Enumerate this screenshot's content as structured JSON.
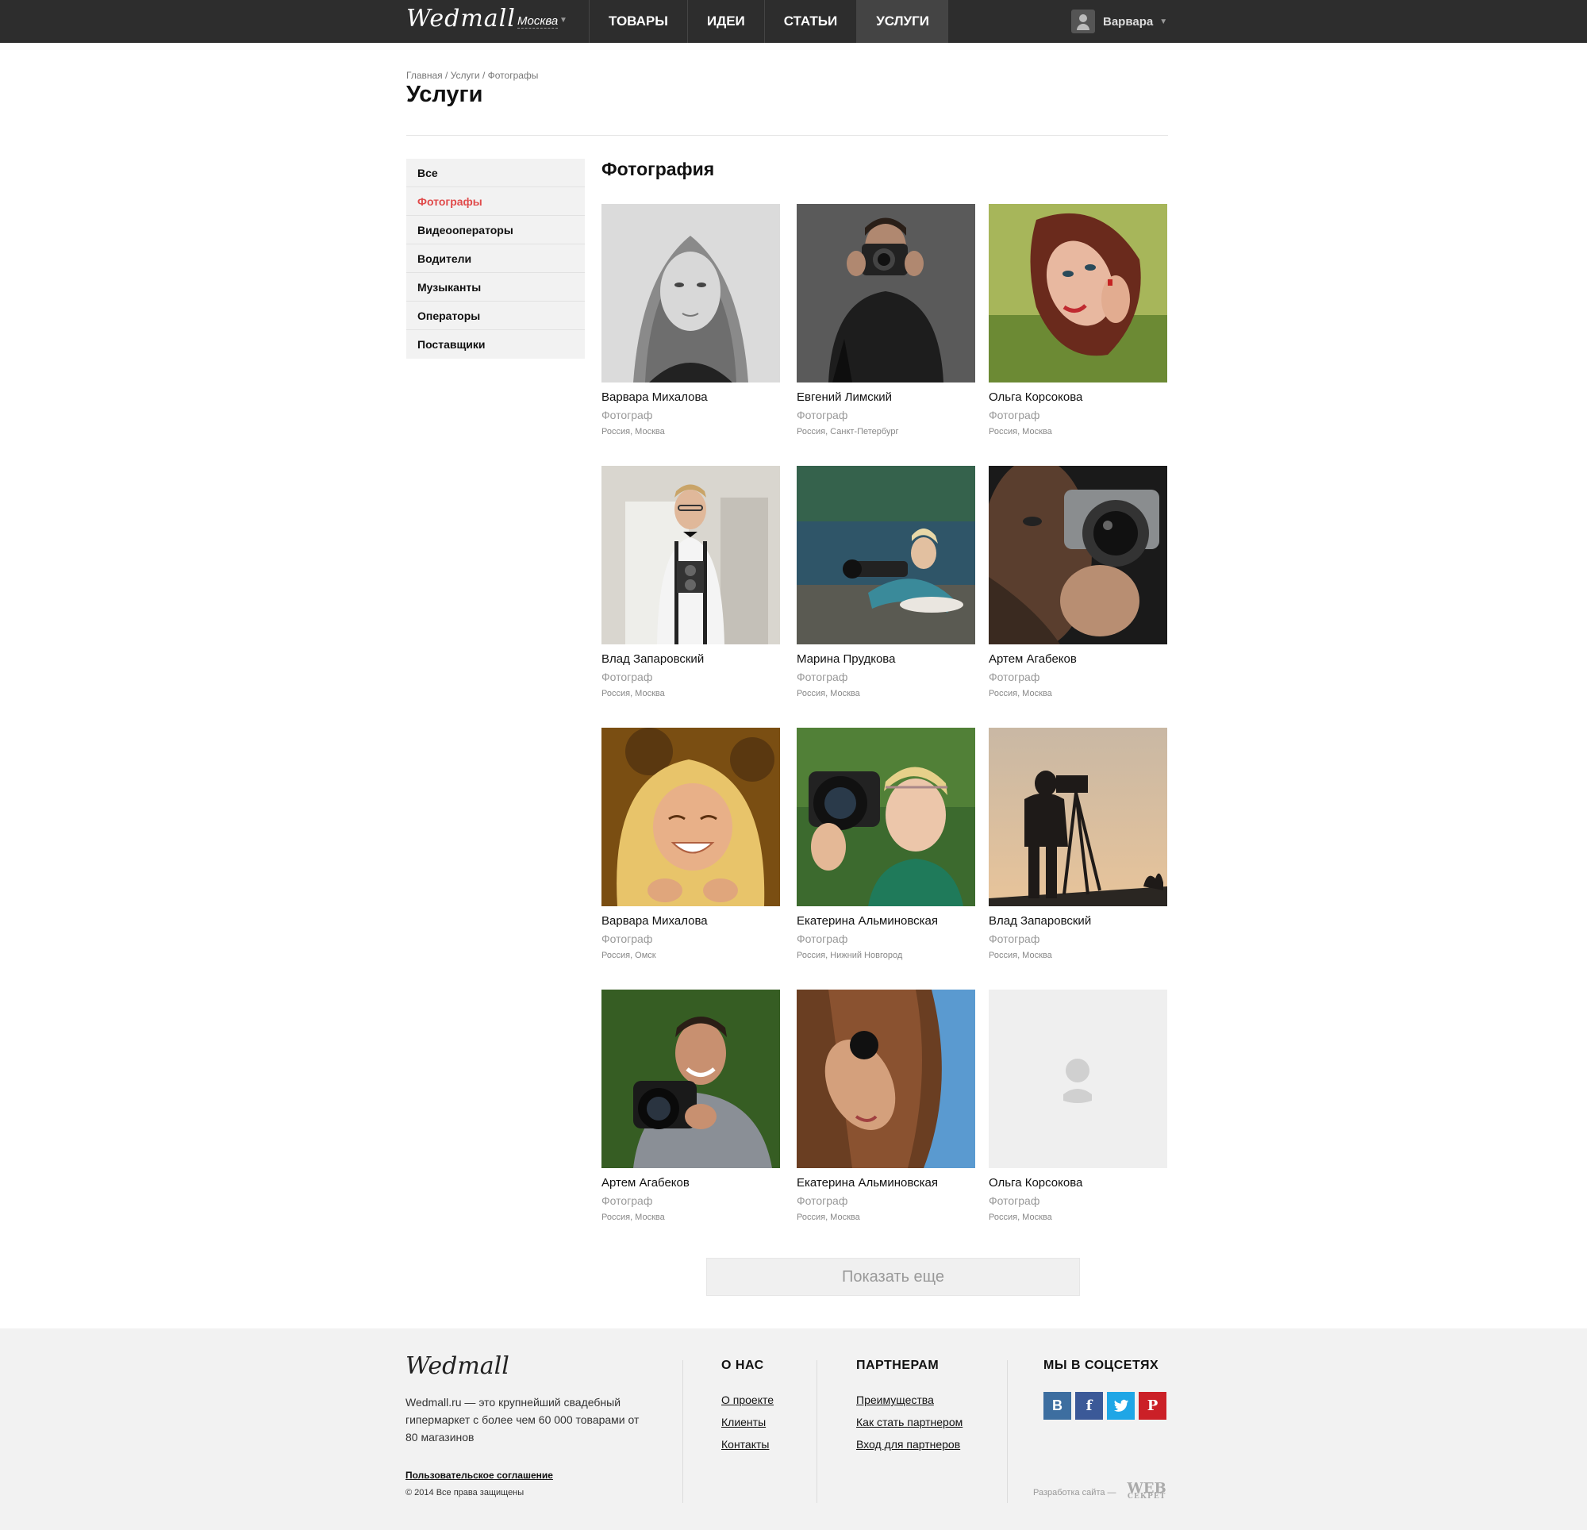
{
  "header": {
    "logo": "Wedmall",
    "city": "Москва",
    "nav": [
      "ТОВАРЫ",
      "ИДЕИ",
      "СТАТЬИ",
      "УСЛУГИ"
    ],
    "active_nav": "УСЛУГИ",
    "user_name": "Варвара"
  },
  "breadcrumb": [
    "Главная",
    "Услуги",
    "Фотографы"
  ],
  "page_title": "Услуги",
  "sidebar": {
    "items": [
      "Все",
      "Фотографы",
      "Видеооператоры",
      "Водители",
      "Музыканты",
      "Операторы",
      "Поставщики"
    ],
    "active": "Фотографы"
  },
  "section_title": "Фотография",
  "cards": [
    {
      "name": "Варвара Михалова",
      "role": "Фотограф",
      "location": "Россия, Москва"
    },
    {
      "name": "Евгений Лимский",
      "role": "Фотограф",
      "location": "Россия, Санкт-Петербург"
    },
    {
      "name": "Ольга Корсокова",
      "role": "Фотограф",
      "location": "Россия, Москва"
    },
    {
      "name": "Влад Запаровский",
      "role": "Фотограф",
      "location": "Россия, Москва"
    },
    {
      "name": "Марина Прудкова",
      "role": "Фотограф",
      "location": "Россия, Москва"
    },
    {
      "name": "Артем Агабеков",
      "role": "Фотограф",
      "location": "Россия, Москва"
    },
    {
      "name": "Варвара Михалова",
      "role": "Фотограф",
      "location": "Россия, Омск"
    },
    {
      "name": "Екатерина Альминовская",
      "role": "Фотограф",
      "location": "Россия, Нижний Новгород"
    },
    {
      "name": "Влад Запаровский",
      "role": "Фотограф",
      "location": "Россия, Москва"
    },
    {
      "name": "Артем Агабеков",
      "role": "Фотограф",
      "location": "Россия, Москва"
    },
    {
      "name": "Екатерина Альминовская",
      "role": "Фотограф",
      "location": "Россия, Москва"
    },
    {
      "name": "Ольга Корсокова",
      "role": "Фотограф",
      "location": "Россия, Москва"
    }
  ],
  "more_button": "Показать еще",
  "footer": {
    "logo": "Wedmall",
    "about": "Wedmall.ru — это крупнейший свадебный гипермаркет с более чем 60 000 товарами от 80 магазинов",
    "terms": "Пользовательское соглашение",
    "copyright": "© 2014 Все права защищены",
    "about_col": {
      "title": "О НАС",
      "links": [
        "О проекте",
        "Клиенты",
        "Контакты"
      ]
    },
    "partners_col": {
      "title": "ПАРТНЕРАМ",
      "links": [
        "Преимущества",
        "Как стать партнером",
        "Вход для партнеров"
      ]
    },
    "social_col": {
      "title": "МЫ В СОЦСЕТЯХ",
      "icons": [
        "vk-icon",
        "facebook-icon",
        "twitter-icon",
        "pinterest-icon"
      ],
      "labels": [
        "В",
        "f",
        "t",
        "P"
      ]
    },
    "dev_text": "Разработка сайта —",
    "dev_logo_top": "WEB",
    "dev_logo_bottom": "СЕКРЕТ"
  },
  "colors": {
    "header_bg": "#2d2d2d",
    "accent": "#e04b4b",
    "footer_bg": "#f2f2f2"
  }
}
